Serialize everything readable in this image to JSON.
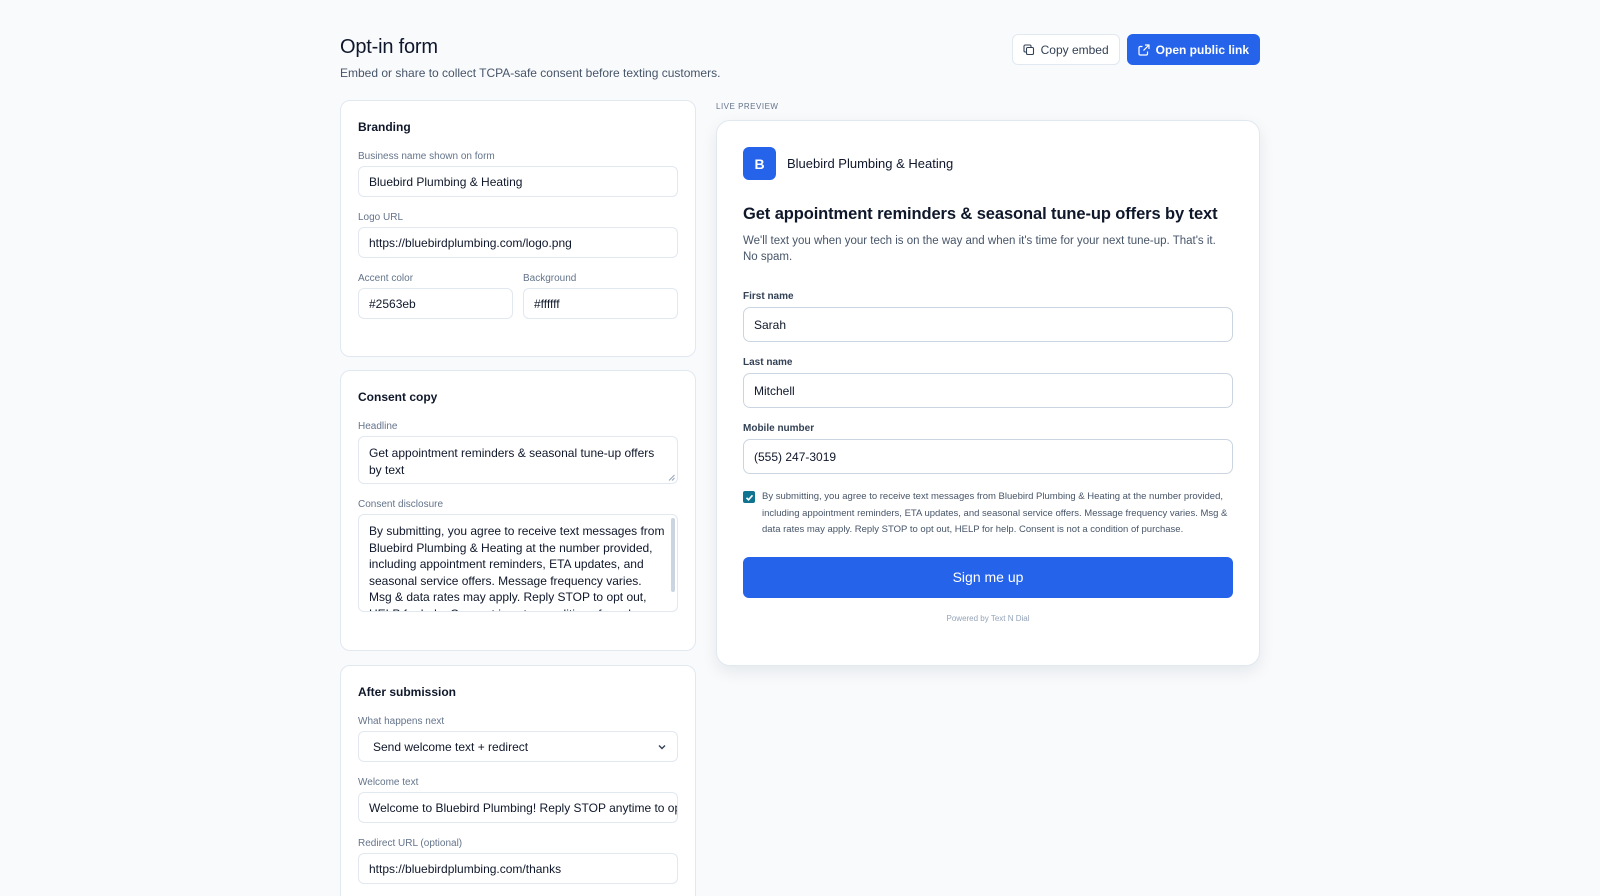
{
  "header": {
    "title": "Opt-in form",
    "subtitle": "Embed or share to collect TCPA-safe consent before texting customers.",
    "copy_embed_label": "Copy embed",
    "open_link_label": "Open public link"
  },
  "branding": {
    "title": "Branding",
    "business_name_label": "Business name shown on form",
    "business_name_value": "Bluebird Plumbing & Heating",
    "logo_url_label": "Logo URL",
    "logo_url_value": "https://bluebirdplumbing.com/logo.png",
    "accent_label": "Accent color",
    "accent_value": "#2563eb",
    "background_label": "Background",
    "background_value": "#ffffff"
  },
  "consent_copy": {
    "title": "Consent copy",
    "headline_label": "Headline",
    "headline_value": "Get appointment reminders & seasonal tune-up offers by text",
    "disclosure_label": "Consent disclosure",
    "disclosure_value": "By submitting, you agree to receive text messages from Bluebird Plumbing & Heating at the number provided, including appointment reminders, ETA updates, and seasonal service offers. Message frequency varies. Msg & data rates may apply. Reply STOP to opt out, HELP for help. Consent is not a condition of purchase."
  },
  "after_submission": {
    "title": "After submission",
    "next_label": "What happens next",
    "next_value": "Send welcome text + redirect",
    "welcome_label": "Welcome text",
    "welcome_value": "Welcome to Bluebird Plumbing! Reply STOP anytime to op",
    "redirect_label": "Redirect URL (optional)",
    "redirect_value": "https://bluebirdplumbing.com/thanks"
  },
  "preview": {
    "caption": "LIVE PREVIEW",
    "logo_letter": "B",
    "business_name": "Bluebird Plumbing & Heating",
    "headline": "Get appointment reminders & seasonal tune-up offers by text",
    "subtext": "We'll text you when your tech is on the way and when it's time for your next tune-up. That's it. No spam.",
    "first_name_label": "First name",
    "first_name_value": "Sarah",
    "last_name_label": "Last name",
    "last_name_value": "Mitchell",
    "mobile_label": "Mobile number",
    "mobile_value": "(555) 247-3019",
    "consent_text": "By submitting, you agree to receive text messages from Bluebird Plumbing & Heating at the number provided, including appointment reminders, ETA updates, and seasonal service offers. Message frequency varies. Msg & data rates may apply. Reply STOP to opt out, HELP for help. Consent is not a condition of purchase.",
    "consent_checked": true,
    "submit_label": "Sign me up",
    "powered_by": "Powered by Text N Dial"
  },
  "colors": {
    "accent": "#2563eb",
    "checkbox": "#0e7490",
    "page_background": "#f8fafc"
  },
  "icons": {
    "copy": "copy-icon",
    "external_link": "external-link-icon",
    "chevron": "chevron-down-icon"
  }
}
